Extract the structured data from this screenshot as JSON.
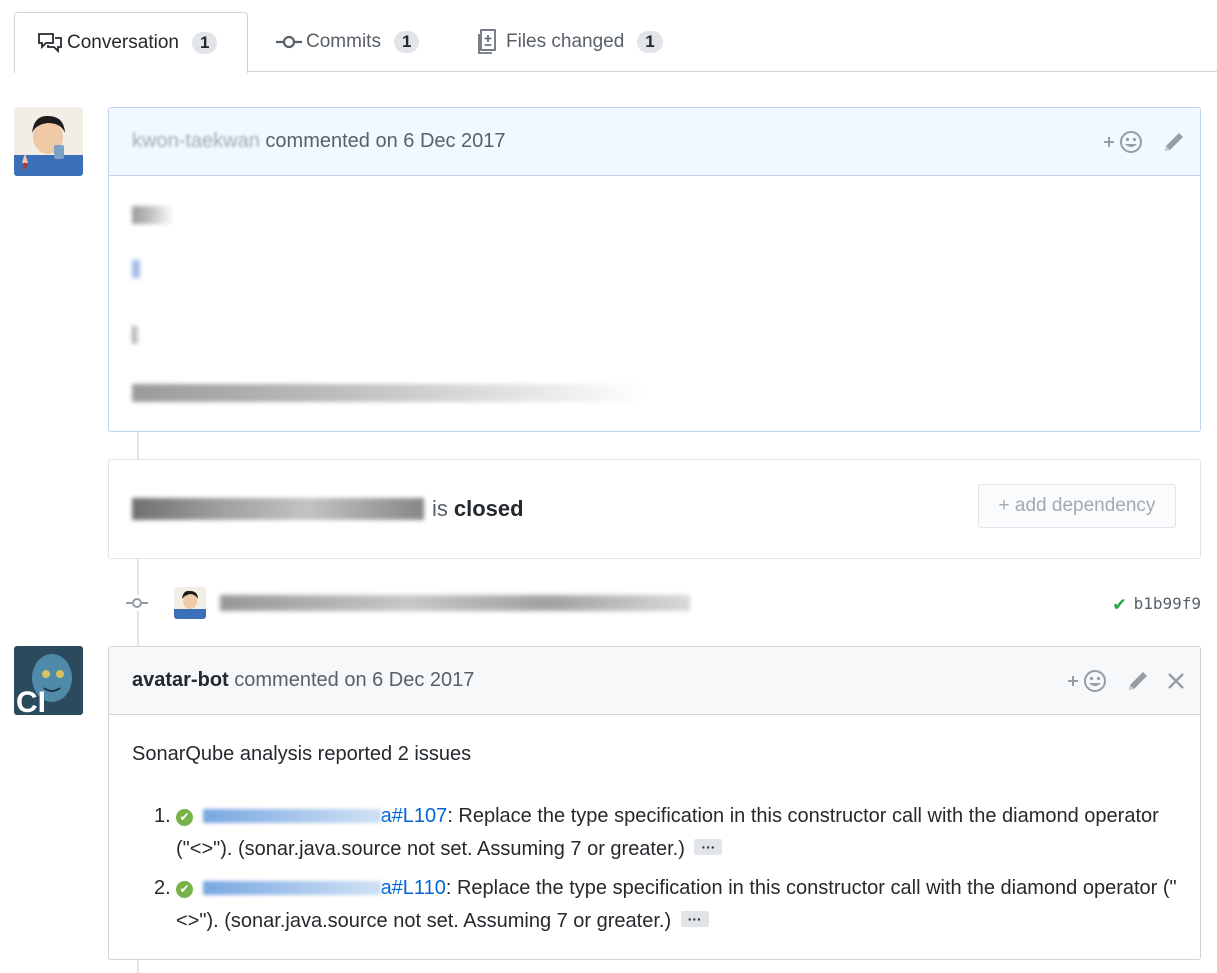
{
  "tabs": [
    {
      "label": "Conversation",
      "count": "1",
      "icon": "comment-discussion-icon"
    },
    {
      "label": "Commits",
      "count": "1",
      "icon": "git-commit-icon"
    },
    {
      "label": "Files changed",
      "count": "1",
      "icon": "diff-icon"
    }
  ],
  "comment1": {
    "author": "kwon-taekwan",
    "meta": "commented on 6 Dec 2017"
  },
  "dependency": {
    "status_text": "is",
    "status": "closed",
    "add_label": "+ add dependency"
  },
  "commit": {
    "sha": "b1b99f9"
  },
  "comment2": {
    "author": "avatar-bot",
    "meta": "commented on 6 Dec 2017",
    "intro": "SonarQube analysis reported 2 issues",
    "issues": [
      {
        "num": "1.",
        "file_suffix": "a#L107",
        "text": ": Replace the type specification in this constructor call with the diamond operator (\"<>\"). (sonar.java.source not set. Assuming 7 or greater.)",
        "more": "···"
      },
      {
        "num": "2.",
        "file_suffix": "a#L110",
        "text": ": Replace the type specification in this constructor call with the diamond operator (\"<>\"). (sonar.java.source not set. Assuming 7 or greater.)",
        "more": "···"
      }
    ]
  },
  "avatar_bot_label": "CI"
}
